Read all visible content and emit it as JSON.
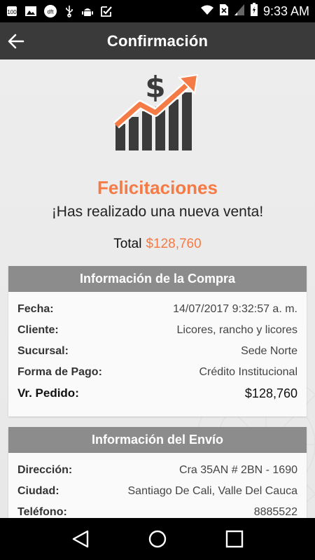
{
  "status_bar": {
    "time": "9:33 AM",
    "notification_icons": [
      "percent-100-icon",
      "image-icon",
      "dft-icon",
      "usb-icon",
      "android-icon",
      "check-box-icon"
    ],
    "dft_label": "dft",
    "badge_label": "100"
  },
  "app_bar": {
    "title": "Confirmación"
  },
  "hero": {
    "heading": "Felicitaciones",
    "message": "¡Has realizado una nueva venta!",
    "total_label": "Total",
    "total_amount": "$128,760"
  },
  "purchase": {
    "header": "Información de la Compra",
    "rows": [
      {
        "label": "Fecha:",
        "value": "14/07/2017 9:32:57 a. m."
      },
      {
        "label": "Cliente:",
        "value": "Licores, rancho y licores"
      },
      {
        "label": "Sucursal:",
        "value": "Sede Norte"
      },
      {
        "label": "Forma de Pago:",
        "value": "Crédito Institucional"
      },
      {
        "label": "Vr. Pedido:",
        "value": "$128,760"
      }
    ]
  },
  "shipping": {
    "header": "Información del Envío",
    "rows": [
      {
        "label": "Dirección:",
        "value": "Cra 35AN # 2BN - 1690"
      },
      {
        "label": "Ciudad:",
        "value": "Santiago De Cali, Valle Del Cauca"
      },
      {
        "label": "Teléfono:",
        "value": "8885522"
      }
    ]
  },
  "colors": {
    "accent": "#f47b45",
    "app_bar": "#3a3a3a",
    "card_header": "#8c8c8c",
    "background": "#ececec"
  }
}
